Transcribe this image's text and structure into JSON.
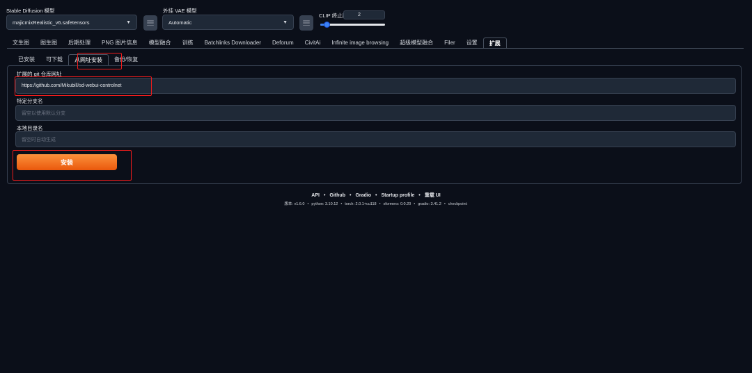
{
  "header": {
    "sd_model_label": "Stable Diffusion 模型",
    "sd_model_value": "majicmixRealistic_v6.safetensors",
    "vae_label": "外挂 VAE 模型",
    "vae_value": "Automatic",
    "clip_label": "CLIP 终止层数",
    "clip_value": "2",
    "clip_slider_fraction": 0.1
  },
  "tabs": [
    "文生图",
    "图生图",
    "后期处理",
    "PNG 图片信息",
    "模型融合",
    "训练",
    "Batchlinks Downloader",
    "Deforum",
    "CivitAi",
    "Infinite image browsing",
    "超级模型融合",
    "Filer",
    "设置",
    "扩展"
  ],
  "active_tab_index": 13,
  "subtabs": [
    "已安装",
    "可下载",
    "从网址安装",
    "备份/恢复"
  ],
  "active_subtab_index": 2,
  "form": {
    "repo_label": "扩展的 git 仓库网址",
    "repo_value": "https://github.com/Mikubill/sd-webui-controlnet",
    "branch_label": "特定分支名",
    "branch_placeholder": "留空以使用默认分支",
    "dir_label": "本地目录名",
    "dir_placeholder": "留空时自动生成",
    "install_label": "安装"
  },
  "footer": {
    "links": [
      "API",
      "Github",
      "Gradio",
      "Startup profile",
      "重载 UI"
    ],
    "separator": "•",
    "versions": [
      "版本: v1.6.0",
      "python: 3.10.12",
      "torch: 2.0.1+cu118",
      "xformers: 0.0.20",
      "gradio: 3.41.2",
      "checkpoint:"
    ]
  },
  "colors": {
    "background": "#0b0f19",
    "input_bg": "#1f2937",
    "accent_orange": "#f97316",
    "highlight_red": "#ef1c1c",
    "slider_blue": "#3b82f6"
  }
}
